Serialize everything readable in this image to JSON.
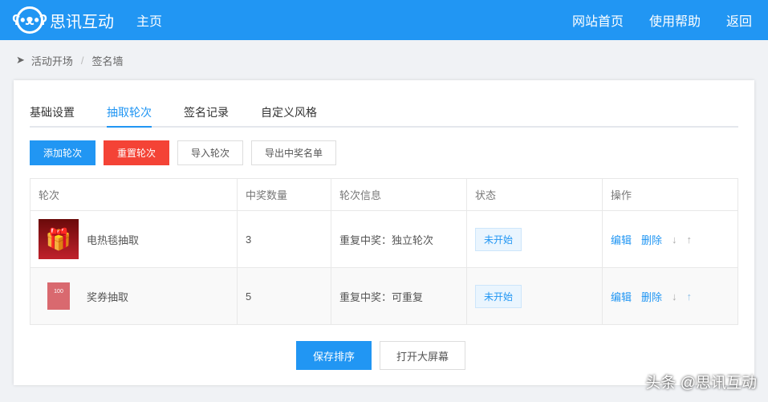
{
  "header": {
    "logo_icon": "bear-face-icon",
    "brand": "思讯互动",
    "home": "主页",
    "links": [
      "网站首页",
      "使用帮助",
      "返回"
    ]
  },
  "breadcrumb": {
    "icon": "paper-plane-icon",
    "items": [
      "活动开场",
      "签名墙"
    ],
    "separator": "/"
  },
  "tabs": [
    "基础设置",
    "抽取轮次",
    "签名记录",
    "自定义风格"
  ],
  "active_tab": 1,
  "toolbar": {
    "add": "添加轮次",
    "reset": "重置轮次",
    "import": "导入轮次",
    "export": "导出中奖名单"
  },
  "table": {
    "headers": [
      "轮次",
      "中奖数量",
      "轮次信息",
      "状态",
      "操作"
    ],
    "rows": [
      {
        "name": "电热毯抽取",
        "count": "3",
        "info": "重复中奖：独立轮次",
        "status": "未开始",
        "edit": "编辑",
        "delete": "删除",
        "down": "↓",
        "up": "↑"
      },
      {
        "name": "奖券抽取",
        "count": "5",
        "info": "重复中奖：可重复",
        "status": "未开始",
        "edit": "编辑",
        "delete": "删除",
        "down": "↓",
        "up": "↑",
        "thumb_text": "100"
      }
    ]
  },
  "footer": {
    "save": "保存排序",
    "open": "打开大屏幕"
  },
  "watermark": "头条 @思讯互动"
}
